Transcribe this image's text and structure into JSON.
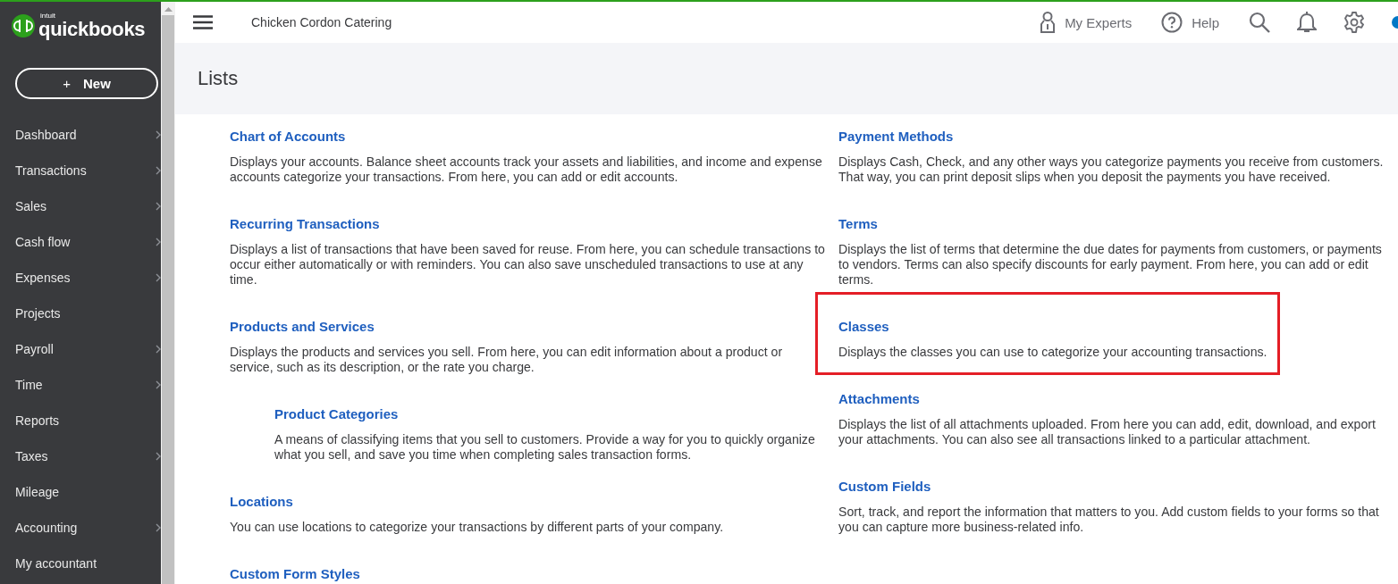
{
  "brand": {
    "small": "intuit",
    "name": "quickbooks"
  },
  "new_button": {
    "icon": "+",
    "label": "New"
  },
  "sidebar": {
    "items": [
      {
        "label": "Dashboard",
        "has_submenu": true
      },
      {
        "label": "Transactions",
        "has_submenu": true
      },
      {
        "label": "Sales",
        "has_submenu": true
      },
      {
        "label": "Cash flow",
        "has_submenu": true
      },
      {
        "label": "Expenses",
        "has_submenu": true
      },
      {
        "label": "Projects",
        "has_submenu": false
      },
      {
        "label": "Payroll",
        "has_submenu": true
      },
      {
        "label": "Time",
        "has_submenu": true
      },
      {
        "label": "Reports",
        "has_submenu": false
      },
      {
        "label": "Taxes",
        "has_submenu": true
      },
      {
        "label": "Mileage",
        "has_submenu": false
      },
      {
        "label": "Accounting",
        "has_submenu": true
      },
      {
        "label": "My accountant",
        "has_submenu": false
      }
    ]
  },
  "topbar": {
    "company": "Chicken Cordon Catering",
    "experts": "My Experts",
    "help": "Help"
  },
  "page_title": "Lists",
  "columns": [
    [
      {
        "title": "Chart of Accounts",
        "description": "Displays your accounts. Balance sheet accounts track your assets and liabilities, and income and expense accounts categorize your transactions. From here, you can add or edit accounts.",
        "highlighted": false
      },
      {
        "title": "Recurring Transactions",
        "description": "Displays a list of transactions that have been saved for reuse. From here, you can schedule transactions to occur either automatically or with reminders. You can also save unscheduled transactions to use at any time.",
        "highlighted": false
      },
      {
        "title": "Products and Services",
        "description": "Displays the products and services you sell. From here, you can edit information about a product or service, such as its description, or the rate you charge.",
        "highlighted": false,
        "children": [
          {
            "title": "Product Categories",
            "description": "A means of classifying items that you sell to customers. Provide a way for you to quickly organize what you sell, and save you time when completing sales transaction forms.",
            "highlighted": false
          }
        ]
      },
      {
        "title": "Locations",
        "description": "You can use locations to categorize your transactions by different parts of your company.",
        "highlighted": false
      },
      {
        "title": "Custom Form Styles",
        "highlighted": false
      }
    ],
    [
      {
        "title": "Payment Methods",
        "description": "Displays Cash, Check, and any other ways you categorize payments you receive from customers. That way, you can print deposit slips when you deposit the payments you have received.",
        "highlighted": false
      },
      {
        "title": "Terms",
        "description": "Displays the list of terms that determine the due dates for payments from customers, or payments to vendors. Terms can also specify discounts for early payment. From here, you can add or edit terms.",
        "highlighted": false
      },
      {
        "title": "Classes",
        "description": "Displays the classes you can use to categorize your accounting transactions.",
        "highlighted": true
      },
      {
        "title": "Attachments",
        "description": "Displays the list of all attachments uploaded. From here you can add, edit, download, and export your attachments. You can also see all transactions linked to a particular attachment.",
        "highlighted": false
      },
      {
        "title": "Custom Fields",
        "description": "Sort, track, and report the information that matters to you. Add custom fields to your forms so that you can capture more business-related info.",
        "highlighted": false
      }
    ]
  ]
}
